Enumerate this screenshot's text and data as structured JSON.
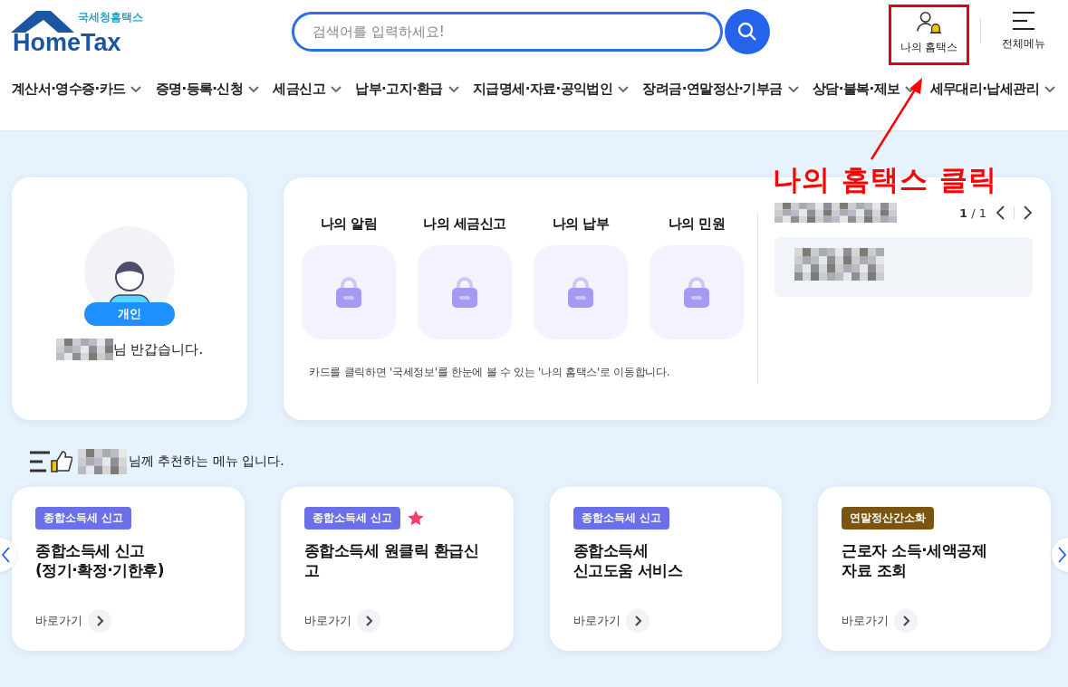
{
  "header": {
    "logo": {
      "subtitle": "국세청홈택스",
      "title": "HomeTax"
    },
    "search": {
      "placeholder": "검색어를 입력하세요!"
    },
    "actions": [
      {
        "kind": "my",
        "label": "나의 홈택스",
        "annotated": true
      },
      {
        "kind": "menu",
        "label": "전체메뉴",
        "annotated": false
      }
    ]
  },
  "nav": [
    "계산서·영수증·카드",
    "증명·등록·신청",
    "세금신고",
    "납부·고지·환급",
    "지급명세·자료·공익법인",
    "장려금·연말정산·기부금",
    "상담·불복·제보",
    "세무대리·납세관리"
  ],
  "annotation": {
    "text": "나의 홈택스 클릭"
  },
  "profile": {
    "badge": "개인",
    "greeting": "님 반갑습니다."
  },
  "my_cards": {
    "tiles": [
      {
        "title": "나의 알림",
        "locked": true
      },
      {
        "title": "나의 세금신고",
        "locked": true
      },
      {
        "title": "나의 납부",
        "locked": true
      },
      {
        "title": "나의 민원",
        "locked": true
      }
    ],
    "note": "카드를 클릭하면 '국세정보'를 한눈에 볼 수 있는 '나의 홈택스'로 이동합니다.",
    "pager": "**1** / 1"
  },
  "recommend": {
    "heading": "님께 추천하는 메뉴 입니다.",
    "cards": [
      {
        "tag": "종합소득세 신고",
        "color": "#6b6fe8",
        "title": "종합소득세 신고\n(정기·확정·기한후)",
        "starred": false,
        "link": "바로가기"
      },
      {
        "tag": "종합소득세 신고",
        "color": "#6b6fe8",
        "title": "종합소득세 원클릭 환급신\n고",
        "starred": true,
        "link": "바로가기"
      },
      {
        "tag": "종합소득세 신고",
        "color": "#6b6fe8",
        "title": "종합소득세\n신고도움 서비스",
        "starred": false,
        "link": "바로가기"
      },
      {
        "tag": "연말정산간소화",
        "color": "#7a5410",
        "title": "근로자 소득·세액공제\n자료 조회",
        "starred": false,
        "link": "바로가기"
      }
    ]
  }
}
